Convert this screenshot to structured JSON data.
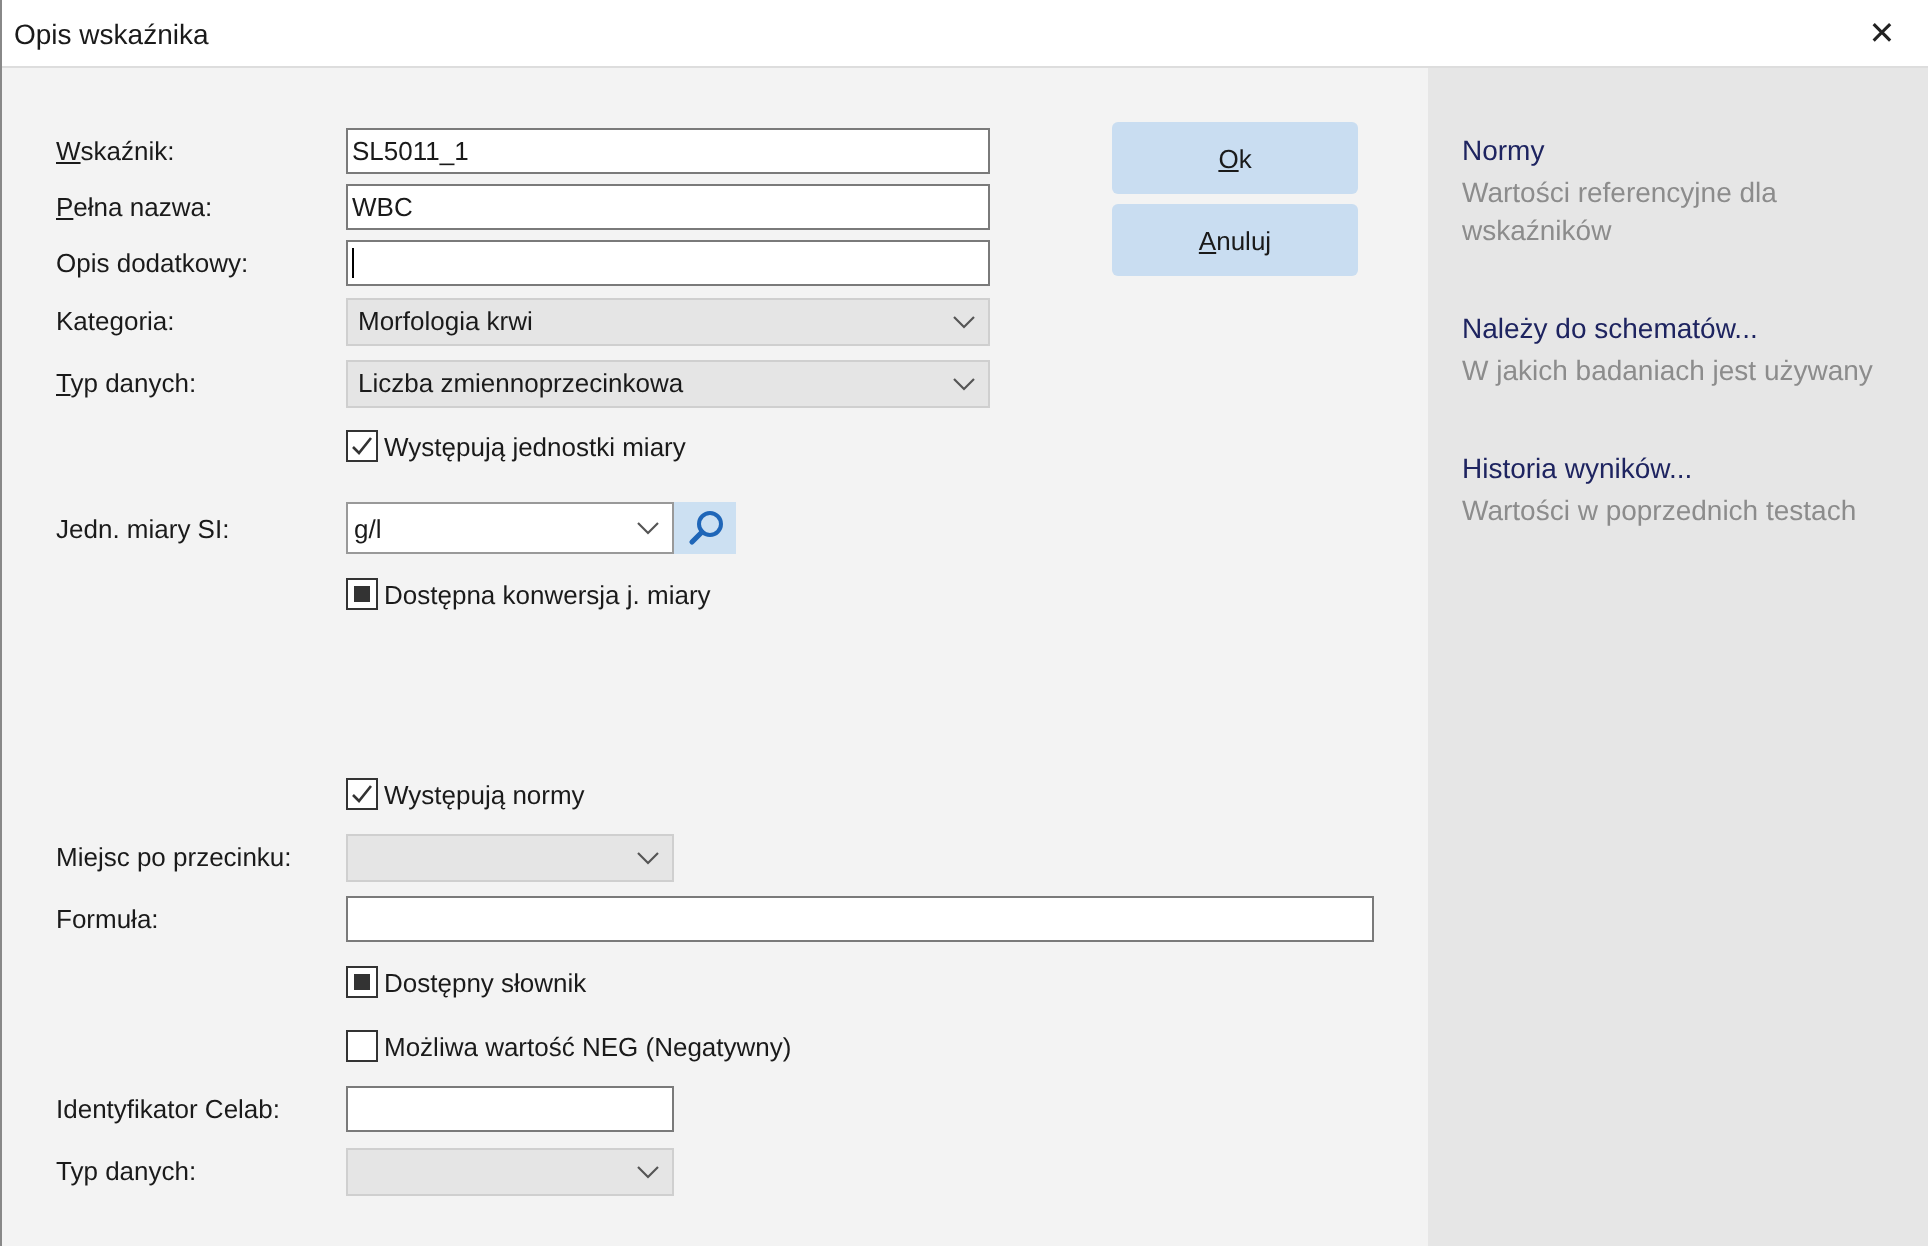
{
  "window": {
    "title": "Opis wskaźnika",
    "close": "✕"
  },
  "form": {
    "sections": [
      {
        "rows": [
          {
            "kind": "text",
            "label": "Wskaźnik:",
            "mnemonic": true,
            "value": "SL5011_1",
            "focused": false
          },
          {
            "kind": "text",
            "label": "Pełna nazwa:",
            "mnemonic": true,
            "value": "WBC",
            "focused": false
          },
          {
            "kind": "text",
            "label": "Opis dodatkowy:",
            "mnemonic": false,
            "value": "",
            "focused": true
          },
          {
            "kind": "select",
            "label": "Kategoria:",
            "mnemonic": false,
            "value": "Morfologia krwi"
          },
          {
            "kind": "select",
            "label": "Typ danych:",
            "mnemonic": true,
            "value": "Liczba zmiennoprzecinkowa"
          },
          {
            "kind": "check",
            "label": "Występują jednostki miary",
            "checked": true,
            "indeterminate": false
          },
          {
            "kind": "combo",
            "label": "Jedn. miary SI:",
            "mnemonic": false,
            "value": "g/l"
          },
          {
            "kind": "check",
            "label": "Dostępna konwersja j. miary",
            "checked": false,
            "indeterminate": true
          }
        ]
      },
      {
        "rows": [
          {
            "kind": "check",
            "label": "Występują normy",
            "checked": true,
            "indeterminate": false
          },
          {
            "kind": "select",
            "label": "Miejsc po przecinku:",
            "mnemonic": false,
            "value": "",
            "wide": false
          },
          {
            "kind": "text",
            "label": "Formuła:",
            "mnemonic": false,
            "value": "",
            "focused": false,
            "wide": true
          },
          {
            "kind": "check",
            "label": "Dostępny słownik",
            "checked": false,
            "indeterminate": true
          },
          {
            "kind": "check",
            "label": "Możliwa wartość NEG (Negatywny)",
            "checked": false,
            "indeterminate": false
          },
          {
            "kind": "text",
            "label": "Identyfikator Celab:",
            "mnemonic": false,
            "value": "",
            "focused": false,
            "wide": false
          },
          {
            "kind": "select",
            "label": "Typ danych:",
            "mnemonic": false,
            "value": "",
            "wide": false
          }
        ]
      }
    ]
  },
  "buttons": [
    {
      "label": "Ok",
      "mnemonic": true
    },
    {
      "label": "Anuluj",
      "mnemonic": true
    }
  ],
  "links": [
    {
      "title": "Normy",
      "description": "Wartości referencyjne dla wskaźników"
    },
    {
      "title": "Należy do schematów...",
      "description": "W jakich badaniach jest używany"
    },
    {
      "title": "Historia wyników...",
      "description": "Wartości w poprzednich testach"
    }
  ]
}
